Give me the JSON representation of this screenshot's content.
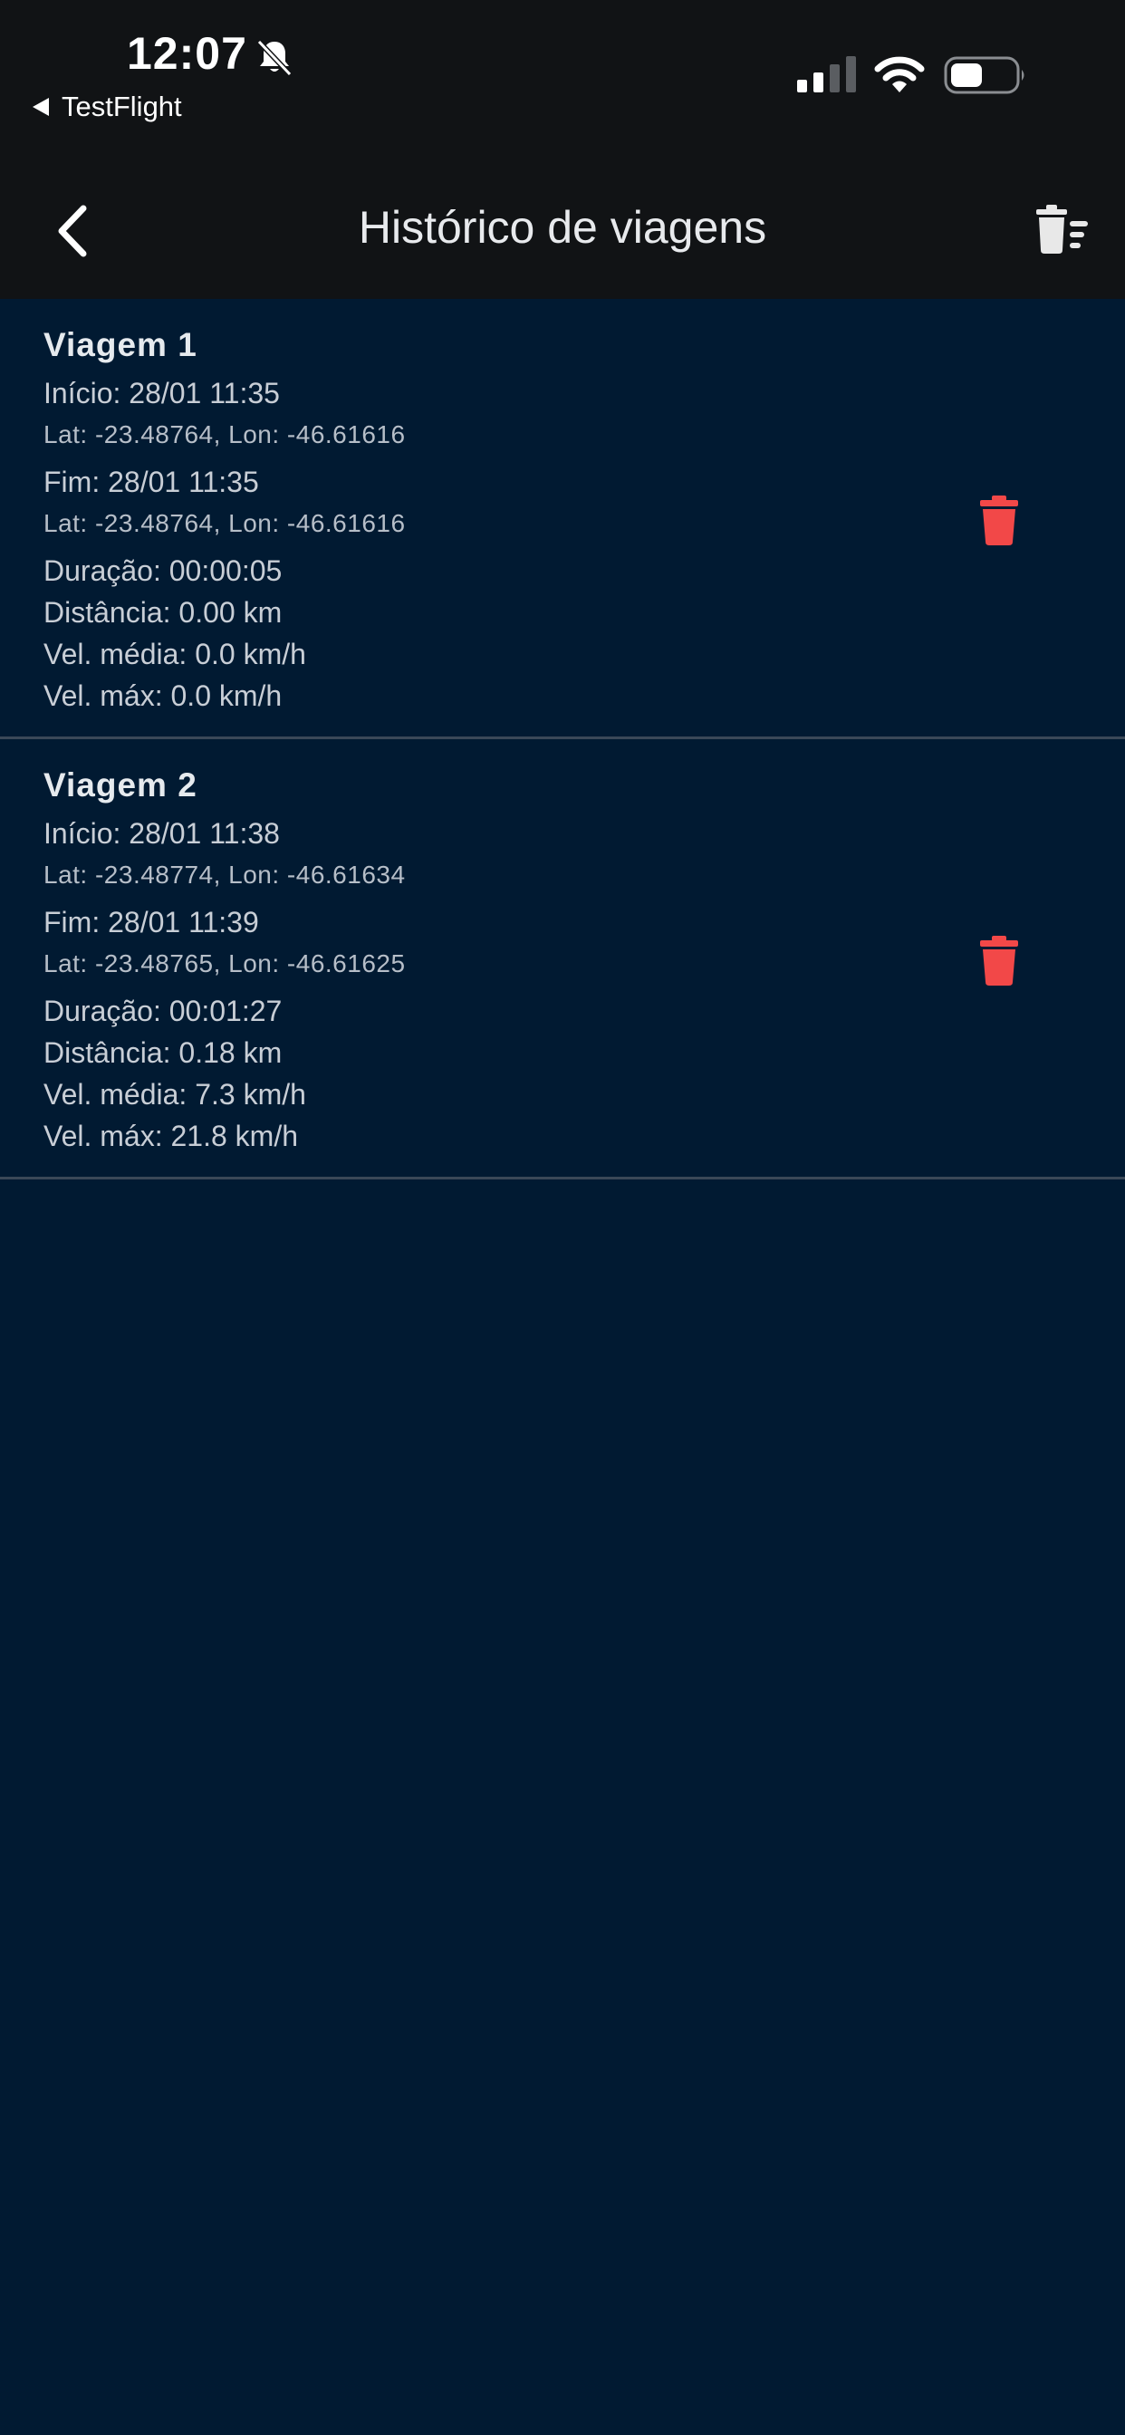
{
  "status_bar": {
    "time": "12:07",
    "back_app": "TestFlight",
    "icons": [
      "bell-slash-icon",
      "signal-icon",
      "wifi-icon",
      "battery-icon"
    ]
  },
  "header": {
    "title": "Histórico de viagens",
    "icons": [
      "back-chevron-icon",
      "clear-list-icon"
    ]
  },
  "colors": {
    "background": "#011a32",
    "header": "#111315",
    "delete": "#f24848",
    "text": "#c8ced6"
  },
  "trips": [
    {
      "title": "Viagem 1",
      "start": "Início: 28/01 11:35",
      "start_coords": "Lat: -23.48764, Lon: -46.61616",
      "end": "Fim: 28/01 11:35",
      "end_coords": "Lat: -23.48764, Lon: -46.61616",
      "duration": "Duração: 00:00:05",
      "distance": "Distância: 0.00 km",
      "avg_speed": "Vel. média: 0.0 km/h",
      "max_speed": "Vel. máx: 0.0 km/h"
    },
    {
      "title": "Viagem 2",
      "start": "Início: 28/01 11:38",
      "start_coords": "Lat: -23.48774, Lon: -46.61634",
      "end": "Fim: 28/01 11:39",
      "end_coords": "Lat: -23.48765, Lon: -46.61625",
      "duration": "Duração: 00:01:27",
      "distance": "Distância: 0.18 km",
      "avg_speed": "Vel. média: 7.3 km/h",
      "max_speed": "Vel. máx: 21.8 km/h"
    }
  ]
}
